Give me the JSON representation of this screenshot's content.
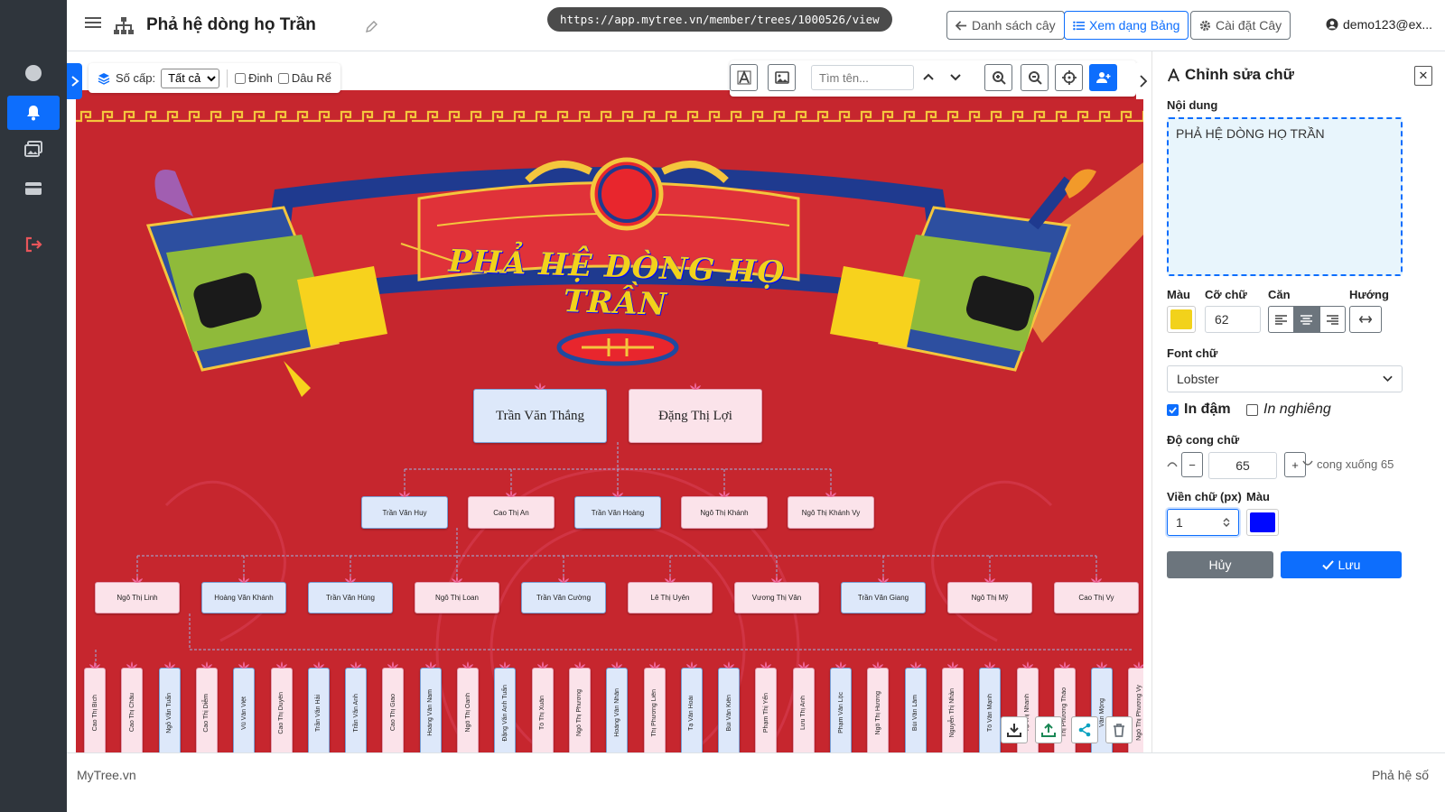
{
  "header": {
    "title": "Phả hệ dòng họ Trần",
    "url": "https://app.mytree.vn/member/trees/1000526/view",
    "buttons": {
      "tree_list": "Danh sách cây",
      "table_view": "Xem dạng Bảng",
      "tree_settings": "Cài đặt Cây"
    },
    "user": "demo123@ex..."
  },
  "toolbar": {
    "level_label": "Số cấp:",
    "level_value": "Tất cả",
    "dinh_label": "Đinh",
    "dau_re_label": "Dâu Rể",
    "search_placeholder": "Tìm tên..."
  },
  "banner": {
    "title": "PHẢ HỆ DÒNG HỌ TRẦN"
  },
  "tree": {
    "gen1": [
      {
        "name": "Trần Văn Thắng",
        "gender": "m"
      },
      {
        "name": "Đặng Thị Lợi",
        "gender": "f"
      }
    ],
    "gen2": [
      {
        "name": "Trần Văn Huy",
        "gender": "m"
      },
      {
        "name": "Cao Thị An",
        "gender": "f"
      },
      {
        "name": "Trần Văn Hoàng",
        "gender": "m"
      },
      {
        "name": "Ngô Thị Khánh",
        "gender": "f"
      },
      {
        "name": "Ngô Thị Khánh Vy",
        "gender": "f"
      }
    ],
    "gen3": [
      {
        "name": "Ngô Thị Linh",
        "gender": "f"
      },
      {
        "name": "Hoàng Văn Khánh",
        "gender": "m"
      },
      {
        "name": "Trần Văn Hùng",
        "gender": "m"
      },
      {
        "name": "Ngô Thị Loan",
        "gender": "f"
      },
      {
        "name": "Trần Văn Cường",
        "gender": "m"
      },
      {
        "name": "Lê Thị Uyên",
        "gender": "f"
      },
      {
        "name": "Vương Thị Vân",
        "gender": "f"
      },
      {
        "name": "Trần Văn Giang",
        "gender": "m"
      },
      {
        "name": "Ngô Thị Mỹ",
        "gender": "f"
      },
      {
        "name": "Cao Thị Vy",
        "gender": "f"
      }
    ],
    "gen4": [
      {
        "name": "Cao Thị Bích",
        "gender": "f"
      },
      {
        "name": "Cao Thị Châu",
        "gender": "f"
      },
      {
        "name": "Ngô Văn Tuấn",
        "gender": "m"
      },
      {
        "name": "Cao Thị Diễm",
        "gender": "f"
      },
      {
        "name": "Vũ Văn Việt",
        "gender": "m"
      },
      {
        "name": "Cao Thị Duyên",
        "gender": "f"
      },
      {
        "name": "Trần Văn Hải",
        "gender": "m"
      },
      {
        "name": "Trần Văn Anh",
        "gender": "m"
      },
      {
        "name": "Cao Thị Giao",
        "gender": "f"
      },
      {
        "name": "Hoàng Văn Nam",
        "gender": "m"
      },
      {
        "name": "Ngô Thị Oanh",
        "gender": "f"
      },
      {
        "name": "Đặng Văn Anh Tuấn",
        "gender": "m"
      },
      {
        "name": "Tô Thị Xuân",
        "gender": "f"
      },
      {
        "name": "Ngô Thị Phương",
        "gender": "f"
      },
      {
        "name": "Hoàng Văn Nhân",
        "gender": "m"
      },
      {
        "name": "Thị Phương Liên",
        "gender": "f"
      },
      {
        "name": "Tạ Văn Hoài",
        "gender": "m"
      },
      {
        "name": "Bùi Văn Kiên",
        "gender": "m"
      },
      {
        "name": "Phạm Thị Yến",
        "gender": "f"
      },
      {
        "name": "Lưu Thị Anh",
        "gender": "f"
      },
      {
        "name": "Phạm Văn Lộc",
        "gender": "m"
      },
      {
        "name": "Ngô Thị Hương",
        "gender": "f"
      },
      {
        "name": "Bùi Văn Lâm",
        "gender": "m"
      },
      {
        "name": "Nguyễn Thị Nhàn",
        "gender": "f"
      },
      {
        "name": "Tô Văn Mạnh",
        "gender": "m"
      },
      {
        "name": "Tạ Thị Nhanh",
        "gender": "f"
      },
      {
        "name": "Thị Phương Thảo",
        "gender": "f"
      },
      {
        "name": "Văn Mộng",
        "gender": "m"
      },
      {
        "name": "Ngô Thị Phương Vy",
        "gender": "f"
      }
    ]
  },
  "panel": {
    "title": "Chỉnh sửa chữ",
    "content_label": "Nội dung",
    "content_value": "PHẢ HỆ DÒNG HỌ TRẦN",
    "color_label": "Màu",
    "color_value": "#f2d21b",
    "size_label": "Cỡ chữ",
    "size_value": "62",
    "align_label": "Căn",
    "direction_label": "Hướng",
    "font_label": "Font chữ",
    "font_value": "Lobster",
    "bold_label": "In đậm",
    "italic_label": "In nghiêng",
    "curve_label": "Độ cong chữ",
    "curve_value": "65",
    "curve_hint": "cong xuống 65",
    "stroke_label": "Viền chữ (px)",
    "stroke_value": "1",
    "stroke_color_label": "Màu",
    "stroke_color_value": "#0008ff",
    "cancel_label": "Hủy",
    "save_label": "Lưu"
  },
  "footer": {
    "left": "MyTree.vn",
    "right": "Phả hệ số"
  }
}
